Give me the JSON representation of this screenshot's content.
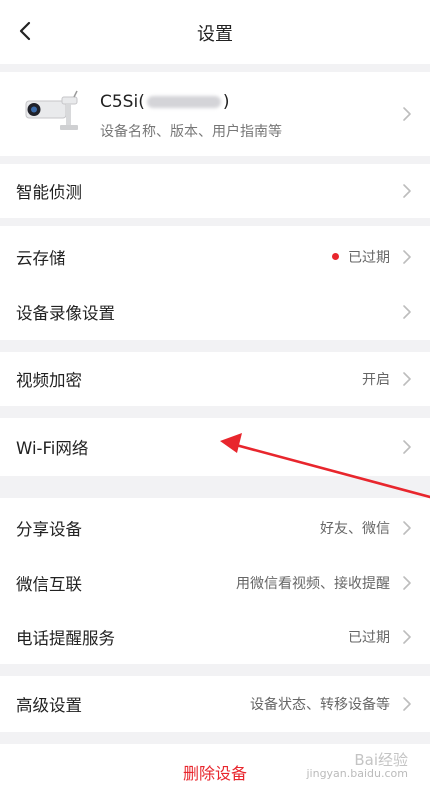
{
  "header": {
    "title": "设置"
  },
  "device": {
    "name_prefix": "C5Si(",
    "name_suffix": ")",
    "subtitle": "设备名称、版本、用户指南等"
  },
  "rows": {
    "smart_detect": {
      "label": "智能侦测"
    },
    "cloud_storage": {
      "label": "云存储",
      "value": "已过期"
    },
    "recording": {
      "label": "设备录像设置"
    },
    "video_encrypt": {
      "label": "视频加密",
      "value": "开启"
    },
    "wifi": {
      "label": "Wi-Fi网络"
    },
    "share": {
      "label": "分享设备",
      "value": "好友、微信"
    },
    "wechat": {
      "label": "微信互联",
      "value": "用微信看视频、接收提醒"
    },
    "phone_alert": {
      "label": "电话提醒服务",
      "value": "已过期"
    },
    "advanced": {
      "label": "高级设置",
      "value": "设备状态、转移设备等"
    }
  },
  "delete_button": {
    "label": "删除设备"
  },
  "watermark": {
    "title": "Bai经验",
    "url": "jingyan.baidu.com"
  },
  "colors": {
    "accent_red": "#e8262d",
    "background": "#f2f2f4",
    "annotation_arrow": "#e8262d"
  },
  "icons": {
    "back": "chevron-left-icon",
    "row_arrow": "chevron-right-icon",
    "device": "camera-icon"
  }
}
